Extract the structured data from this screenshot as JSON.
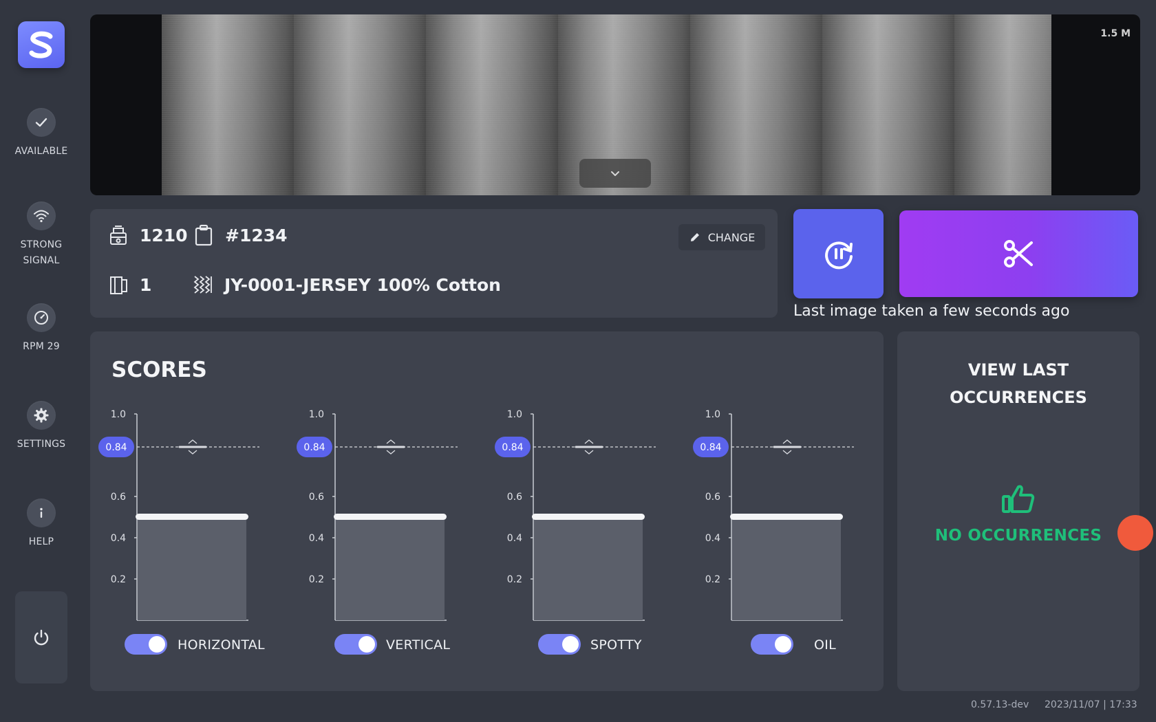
{
  "sidebar": {
    "items": [
      {
        "label": "AVAILABLE",
        "icon": "check-icon"
      },
      {
        "label": "STRONG\nSIGNAL",
        "icon": "wifi-icon"
      },
      {
        "label": "RPM 29",
        "icon": "speedometer-icon"
      },
      {
        "label": "SETTINGS",
        "icon": "gear-icon"
      },
      {
        "label": "HELP",
        "icon": "info-icon"
      }
    ],
    "power_icon": "power-icon"
  },
  "camera": {
    "scale_label": "1.5 M"
  },
  "info": {
    "machine": "1210",
    "order": "#1234",
    "roll": "1",
    "article": "JY-0001-JERSEY 100% Cotton",
    "change_label": "CHANGE"
  },
  "actions": {
    "last_image": "Last image taken a few seconds ago"
  },
  "scores": {
    "title": "SCORES",
    "threshold_label": "0.84"
  },
  "chart_data": {
    "type": "bar",
    "categories": [
      "HORIZONTAL",
      "VERTICAL",
      "SPOTTY",
      "OIL"
    ],
    "values": [
      0.5,
      0.5,
      0.5,
      0.5
    ],
    "threshold": 0.84,
    "ylim": [
      0,
      1.0
    ],
    "yticks": [
      "0.2",
      "0.4",
      "0.6",
      "1.0"
    ],
    "toggles": [
      true,
      true,
      true,
      true
    ]
  },
  "occurrences": {
    "title_line1": "VIEW LAST",
    "title_line2": "OCCURRENCES",
    "status": "NO OCCURRENCES"
  },
  "footer": {
    "version": "0.57.13-dev",
    "datetime": "2023/11/07 | 17:33"
  },
  "colors": {
    "accent": "#5b63ec",
    "cut_gradient_start": "#a03cf2",
    "ok_green": "#1fbf7a",
    "toggle_on": "#7a84f5"
  }
}
